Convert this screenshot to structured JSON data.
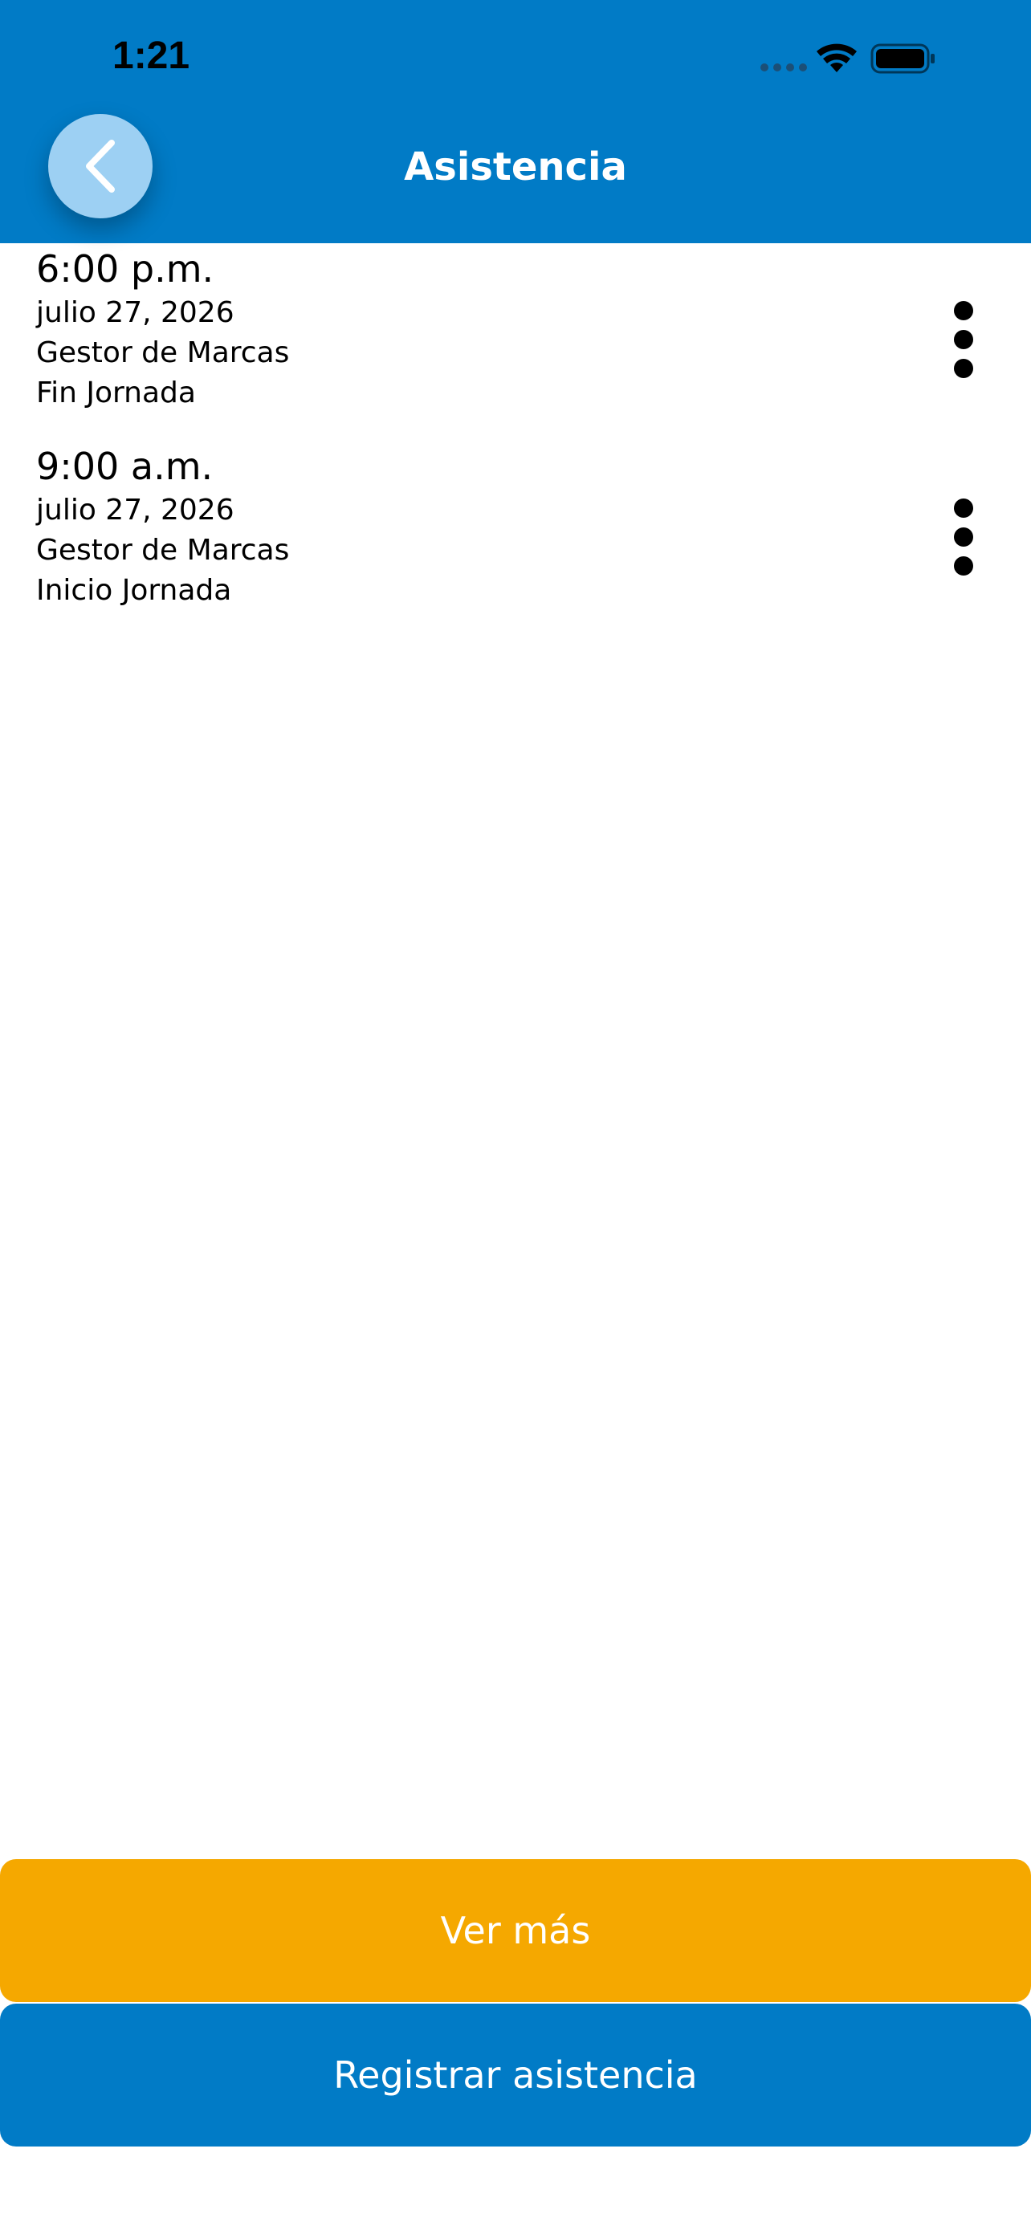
{
  "status_bar": {
    "time": "1:21"
  },
  "header": {
    "title": "Asistencia",
    "background_color": "#017bc6",
    "back_icon": "chevron-left-icon"
  },
  "records": [
    {
      "time": "6:00 p.m.",
      "date": "julio 27, 2026",
      "source": "Gestor de Marcas",
      "type": "Fin Jornada"
    },
    {
      "time": "9:00 a.m.",
      "date": "julio 27, 2026",
      "source": "Gestor de Marcas",
      "type": "Inicio Jornada"
    }
  ],
  "buttons": {
    "more_label": "Ver más",
    "more_color": "#f5a800",
    "register_label": "Registrar asistencia",
    "register_color": "#017bc6"
  }
}
